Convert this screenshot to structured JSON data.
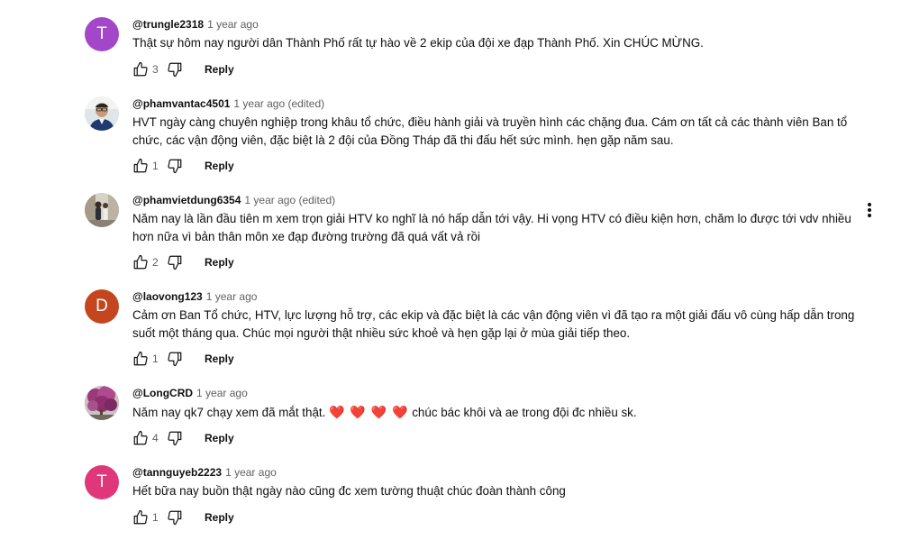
{
  "comments": [
    {
      "handle": "@trungle2318",
      "time": "1 year ago",
      "text": "Thật sự hôm nay người dân Thành Phố rất tự hào về 2 ekip của đội xe đạp Thành Phố. Xin CHÚC MỪNG.",
      "likes": "3",
      "reply_label": "Reply",
      "avatar_letter": "T",
      "avatar_color": "#a347c8"
    },
    {
      "handle": "@phamvantac4501",
      "time": "1 year ago (edited)",
      "text": "HVT ngày càng chuyên nghiệp trong khâu tổ chức, điều hành giải và truyền hình các chặng đua. Cám ơn tất cả các thành viên Ban tổ chức, các vận động viên, đặc biệt là 2 đội của Đồng Tháp đã thi đấu hết sức mình. hẹn gặp năm sau.",
      "likes": "1",
      "reply_label": "Reply",
      "avatar_letter": "",
      "avatar_color": "#e8ecef"
    },
    {
      "handle": "@phamvietdung6354",
      "time": "1 year ago (edited)",
      "text": "Năm nay là lần đầu tiên m xem trọn giải HTV ko nghĩ là nó hấp dẫn tới vậy. Hi vọng HTV có điều kiện hơn, chăm lo được tới vdv nhiều hơn nữa vì bản thân môn xe đạp đường trường đã quá vất vả rồi",
      "likes": "2",
      "reply_label": "Reply",
      "avatar_letter": "",
      "avatar_color": "#cfc7bd"
    },
    {
      "handle": "@laovong123",
      "time": "1 year ago",
      "text": "Cảm ơn Ban Tổ chức, HTV, lực lượng hỗ trợ, các ekip và đặc biệt là các vận động viên vì đã tạo ra một giải đấu vô cùng hấp dẫn trong suốt một tháng qua. Chúc mọi người thật nhiều sức khoẻ và hẹn gặp lại ở mùa giải tiếp theo.",
      "likes": "1",
      "reply_label": "Reply",
      "avatar_letter": "D",
      "avatar_color": "#c4461e"
    },
    {
      "handle": "@LongCRD",
      "time": "1 year ago",
      "text": "Năm nay qk7 chạy xem đã mắt thật.",
      "hearts": "❤️ ❤️ ❤️ ❤️",
      "text_after": "chúc bác khôi và ae trong đội đc nhiều sk.",
      "likes": "4",
      "reply_label": "Reply",
      "avatar_letter": "",
      "avatar_color": "#8a6a8c"
    },
    {
      "handle": "@tannguyeb2223",
      "time": "1 year ago",
      "text": "Hết bữa nay buồn thật ngày nào cũng đc xem tường thuật chúc đoàn thành công",
      "likes": "1",
      "reply_label": "Reply",
      "avatar_letter": "T",
      "avatar_color": "#e0367a"
    }
  ],
  "icons": {
    "like": "thumbs-up-icon",
    "dislike": "thumbs-down-icon",
    "more": "more-vertical-icon"
  }
}
